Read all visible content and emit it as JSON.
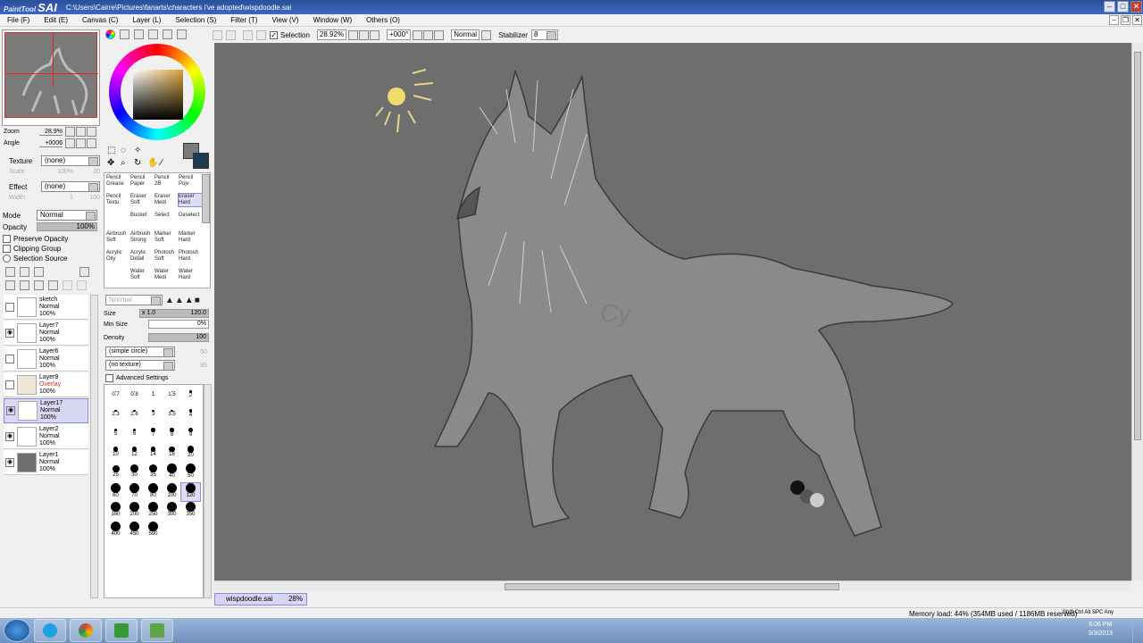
{
  "window": {
    "app_name": "PaintTool",
    "app_brand": "SAI",
    "path": "C:\\Users\\Cairre\\Pictures\\fanarts\\characters i've adopted\\wispdoodle.sai",
    "min": "–",
    "max": "□",
    "close": "✕"
  },
  "menu": [
    "File (F)",
    "Edit (E)",
    "Canvas (C)",
    "Layer (L)",
    "Selection (S)",
    "Filter (T)",
    "View (V)",
    "Window (W)",
    "Others (O)"
  ],
  "navigator": {
    "zoom_label": "Zoom",
    "zoom_value": "28.9%",
    "angle_label": "Angle",
    "angle_value": "+0006"
  },
  "props": {
    "texture_label": "Texture",
    "texture_value": "(none)",
    "scale_label": "Scale",
    "scale_value": "100%",
    "scale_num": "20",
    "effect_label": "Effect",
    "effect_value": "(none)",
    "width_label": "Width",
    "width_value": "1",
    "width_num": "100",
    "mode_label": "Mode",
    "mode_value": "Normal",
    "opacity_label": "Opacity",
    "opacity_value": "100%"
  },
  "checks": {
    "preserve": "Preserve Opacity",
    "clipping": "Clipping Group",
    "selsrc": "Selection Source"
  },
  "layers": [
    {
      "name": "sketch",
      "mode": "Normal",
      "opacity": "100%",
      "visible": false
    },
    {
      "name": "Layer7",
      "mode": "Normal",
      "opacity": "100%",
      "visible": true
    },
    {
      "name": "Layer6",
      "mode": "Normal",
      "opacity": "100%",
      "visible": false
    },
    {
      "name": "Layer9",
      "mode": "Overlay",
      "opacity": "100%",
      "visible": false
    },
    {
      "name": "Layer17",
      "mode": "Normal",
      "opacity": "100%",
      "visible": true
    },
    {
      "name": "Layer2",
      "mode": "Normal",
      "opacity": "100%",
      "visible": true
    },
    {
      "name": "Layer1",
      "mode": "Normal",
      "opacity": "100%",
      "visible": true
    }
  ],
  "tools": [
    [
      "Pencil",
      "Grease"
    ],
    [
      "Pencil",
      "Paper"
    ],
    [
      "Pencil",
      "2B"
    ],
    [
      "Pencil",
      "Pojv"
    ],
    [
      "Pencil",
      "Textu"
    ],
    [
      "Eraser",
      "Soft"
    ],
    [
      "Eraser",
      "Medi"
    ],
    [
      "Eraser",
      "Hard"
    ],
    [
      "",
      ""
    ],
    [
      "Bucket",
      ""
    ],
    [
      "Select",
      ""
    ],
    [
      "Deselect",
      ""
    ],
    [
      "Airbrush",
      "Soft"
    ],
    [
      "Airbrush",
      "Strong"
    ],
    [
      "Marker",
      "Soft"
    ],
    [
      "Marker",
      "Hard"
    ],
    [
      "Acrylic",
      "Oily"
    ],
    [
      "Acrylic",
      "Detail"
    ],
    [
      "Photosh",
      "Soft"
    ],
    [
      "Photosh",
      "Hard"
    ],
    [
      "",
      ""
    ],
    [
      "Water",
      "Soft"
    ],
    [
      "Water",
      "Medi"
    ],
    [
      "Water",
      "Hard"
    ]
  ],
  "brush": {
    "mode": "Normal",
    "size_label": "Size",
    "size_mult": "x 1.0",
    "size_value": "120.0",
    "minsize_label": "Min Size",
    "minsize_value": "0%",
    "density_label": "Density",
    "density_value": "100",
    "shape": "(simple circle)",
    "shape_num": "50",
    "texture": "(no texture)",
    "texture_num": "95",
    "advanced": "Advanced Settings"
  },
  "sizes": [
    "0.7",
    "0.8",
    "1",
    "1.5",
    "2",
    "2.3",
    "2.6",
    "3",
    "3.5",
    "4",
    "5",
    "6",
    "7",
    "8",
    "9",
    "10",
    "12",
    "14",
    "16",
    "20",
    "25",
    "30",
    "35",
    "40",
    "50",
    "60",
    "70",
    "80",
    "100",
    "120",
    "160",
    "200",
    "250",
    "300",
    "350",
    "400",
    "450",
    "500"
  ],
  "toolbar": {
    "selection": "Selection",
    "zoom": "28.92%",
    "angle": "+000°",
    "blend": "Normal",
    "stabilizer_label": "Stabilizer",
    "stabilizer_value": "8"
  },
  "filetab": {
    "name": "wispdoodle.sai",
    "zoom": "28%"
  },
  "status": {
    "memory": "Memory load: 44% (354MB used / 1186MB reserved)",
    "keys": "Shift Ctrl Alt SPC Any"
  },
  "clock": {
    "time": "6:06 PM",
    "date": "3/3/2013"
  },
  "colors": {
    "main": "#7b7b7b",
    "sub": "#1f3a4a",
    "accent": "#8a8ae0"
  }
}
